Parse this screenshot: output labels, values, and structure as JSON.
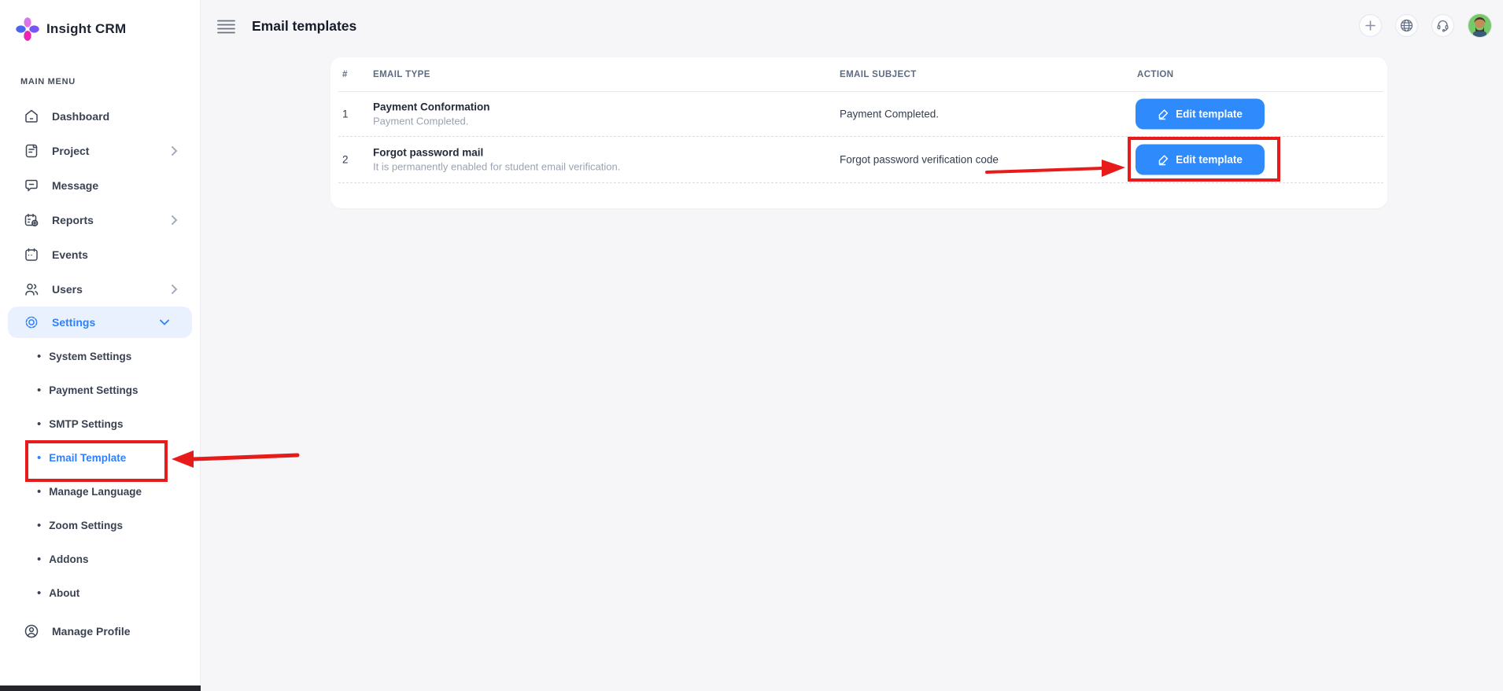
{
  "app": {
    "name": "Insight CRM"
  },
  "sidebar": {
    "section_label": "MAIN MENU",
    "items": [
      {
        "label": "Dashboard",
        "icon": "home-icon"
      },
      {
        "label": "Project",
        "icon": "document-icon",
        "chevron": "right"
      },
      {
        "label": "Message",
        "icon": "message-icon"
      },
      {
        "label": "Reports",
        "icon": "report-icon",
        "chevron": "right"
      },
      {
        "label": "Events",
        "icon": "calendar-icon"
      },
      {
        "label": "Users",
        "icon": "users-icon",
        "chevron": "right"
      },
      {
        "label": "Settings",
        "icon": "gear-icon",
        "chevron": "down",
        "active": true
      }
    ],
    "submenu": [
      {
        "label": "System Settings"
      },
      {
        "label": "Payment Settings"
      },
      {
        "label": "SMTP Settings"
      },
      {
        "label": "Email Template",
        "active": true
      },
      {
        "label": "Manage Language"
      },
      {
        "label": "Zoom Settings"
      },
      {
        "label": "Addons"
      },
      {
        "label": "About"
      }
    ],
    "profile_label": "Manage Profile"
  },
  "header": {
    "title": "Email templates",
    "actions": [
      "add-icon",
      "globe-icon",
      "support-headset-icon",
      "user-avatar"
    ]
  },
  "table": {
    "columns": {
      "num": "#",
      "type": "EMAIL TYPE",
      "subject": "EMAIL SUBJECT",
      "action": "ACTION"
    },
    "rows": [
      {
        "num": "1",
        "type_title": "Payment Conformation",
        "type_subtitle": "Payment Completed.",
        "subject": "Payment Completed.",
        "action_label": "Edit template"
      },
      {
        "num": "2",
        "type_title": "Forgot password mail",
        "type_subtitle": "It is permanently enabled for student email verification.",
        "subject": "Forgot password verification code",
        "action_label": "Edit template"
      }
    ]
  },
  "annotations": {
    "highlighted_sidebar_item": "Email Template",
    "highlighted_button": "Edit template (row 2)",
    "color": "#e81b1b"
  },
  "colors": {
    "accent_blue": "#2f8bfb",
    "active_pill_bg": "#e9f1fe",
    "page_bg": "#f6f6f9",
    "annotation_red": "#e81b1b",
    "avatar_bg": "#76c869"
  }
}
